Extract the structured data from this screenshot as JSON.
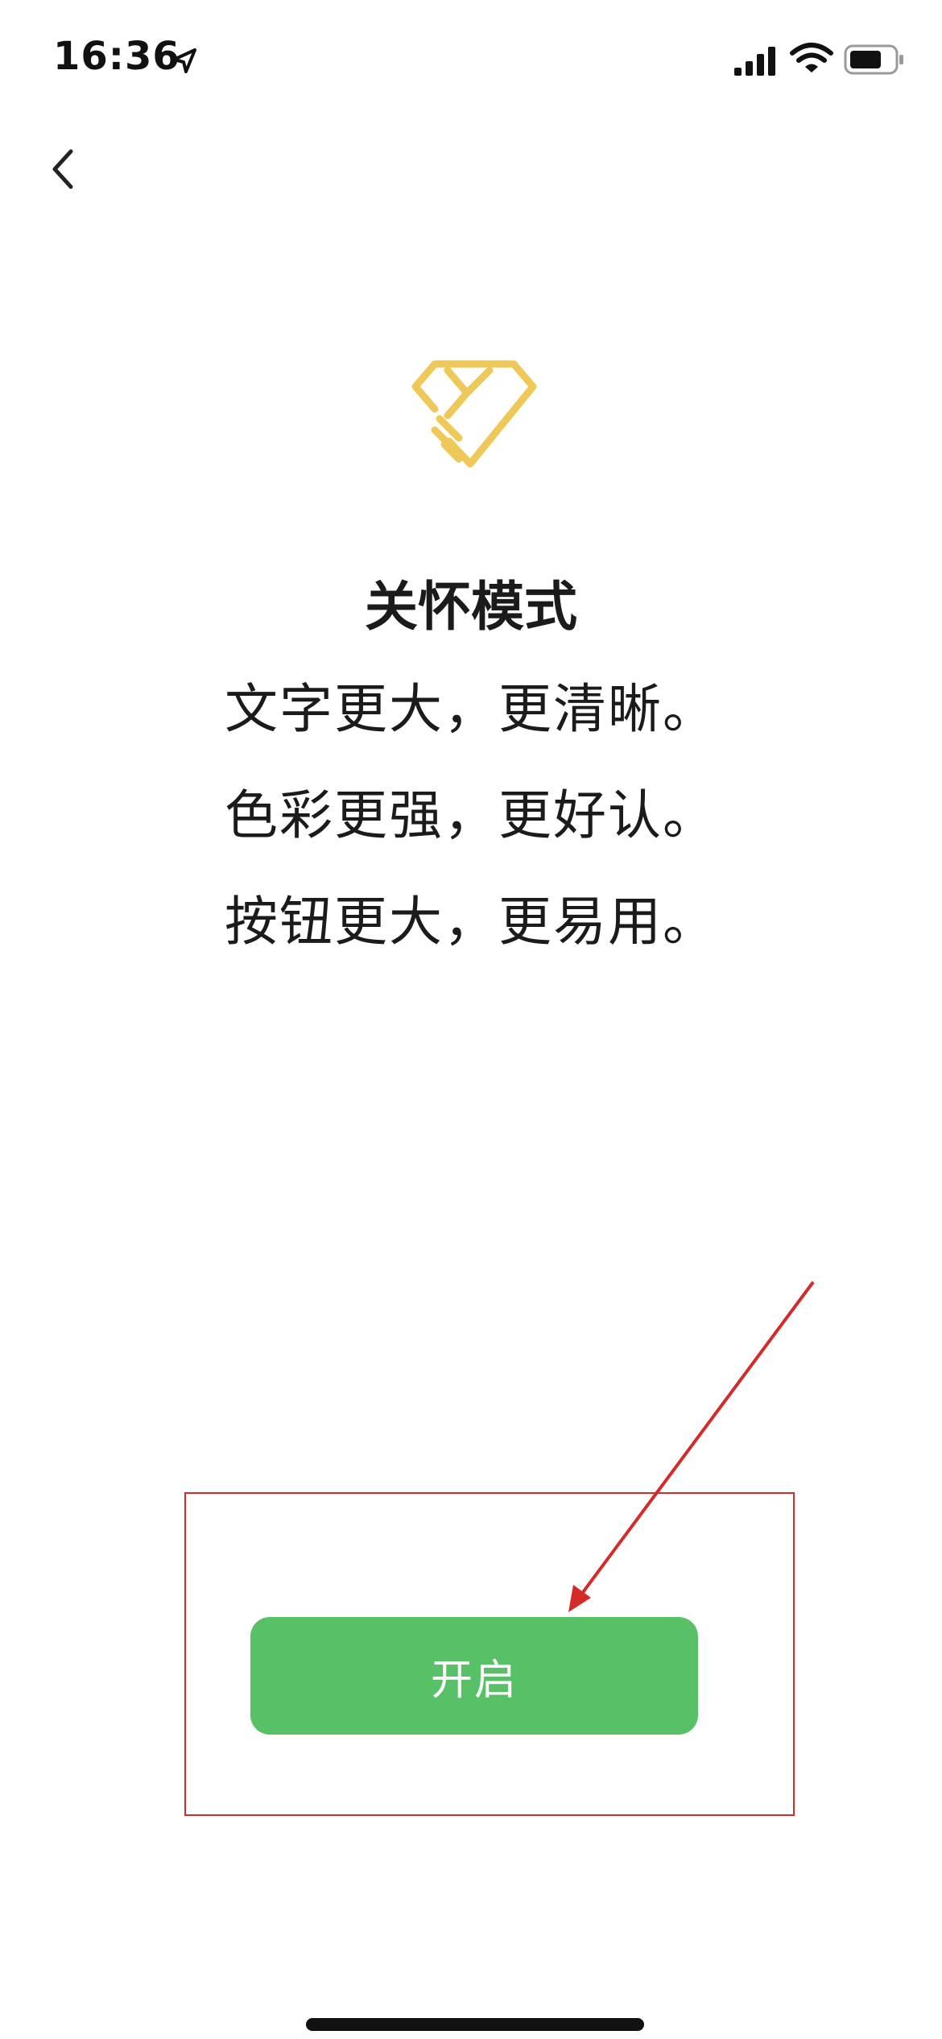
{
  "status_bar": {
    "time": "16:36",
    "location_icon": "location-arrow-icon",
    "signal_icon": "cellular-signal-icon",
    "wifi_icon": "wifi-icon",
    "battery_icon": "battery-icon"
  },
  "nav": {
    "back_icon": "chevron-left-icon"
  },
  "content": {
    "logo_icon": "care-mode-heart-hand-icon",
    "title": "关怀模式",
    "lines": [
      "文字更大，更清晰。",
      "色彩更强，更好认。",
      "按钮更大，更易用。"
    ]
  },
  "actions": {
    "enable_label": "开启"
  },
  "colors": {
    "accent_green": "#58c167",
    "logo_yellow": "#eec95a",
    "annotation_red": "#d52a2a"
  }
}
